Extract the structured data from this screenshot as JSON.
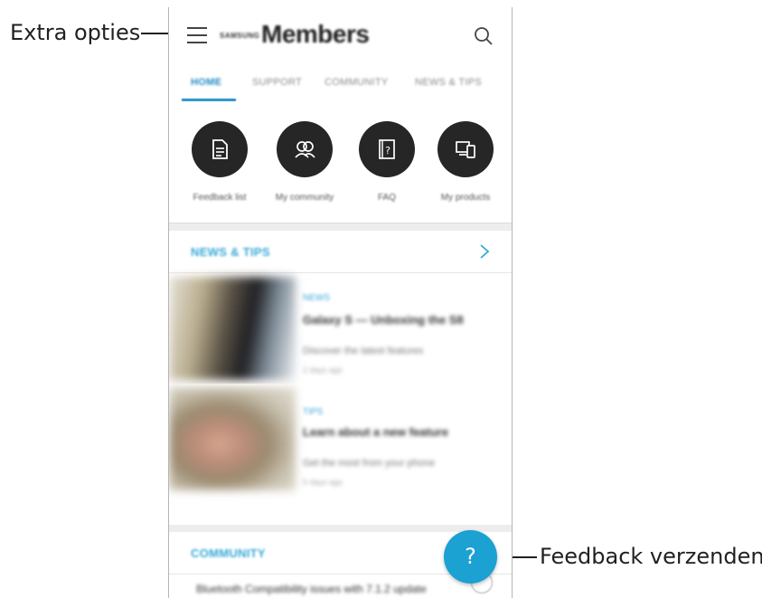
{
  "callouts": {
    "menu": "Extra opties",
    "feedback": "Feedback verzenden"
  },
  "appbar": {
    "brand": "SAMSUNG",
    "title": "Members"
  },
  "tabs": [
    "HOME",
    "SUPPORT",
    "COMMUNITY",
    "NEWS & TIPS"
  ],
  "quick_actions": [
    {
      "label": "Feedback list",
      "icon": "document-icon"
    },
    {
      "label": "My community",
      "icon": "people-icon"
    },
    {
      "label": "FAQ",
      "icon": "question-book-icon"
    },
    {
      "label": "My products",
      "icon": "devices-icon"
    }
  ],
  "news": {
    "title": "NEWS & TIPS",
    "articles": [
      {
        "category": "NEWS",
        "title": "Galaxy S — Unboxing the S8",
        "subtitle": "Discover the latest features",
        "meta": "2 days ago"
      },
      {
        "category": "TIPS",
        "title": "Learn about a new feature",
        "subtitle": "Get the most from your phone",
        "meta": "5 days ago"
      }
    ]
  },
  "community": {
    "title": "COMMUNITY",
    "row": "Bluetooth Compatibility issues with 7.1.2 update"
  },
  "fab": {
    "label": "?"
  },
  "colors": {
    "accent": "#1ba1d2",
    "tab_active": "#1d8bc3",
    "button_dark": "#262626"
  }
}
